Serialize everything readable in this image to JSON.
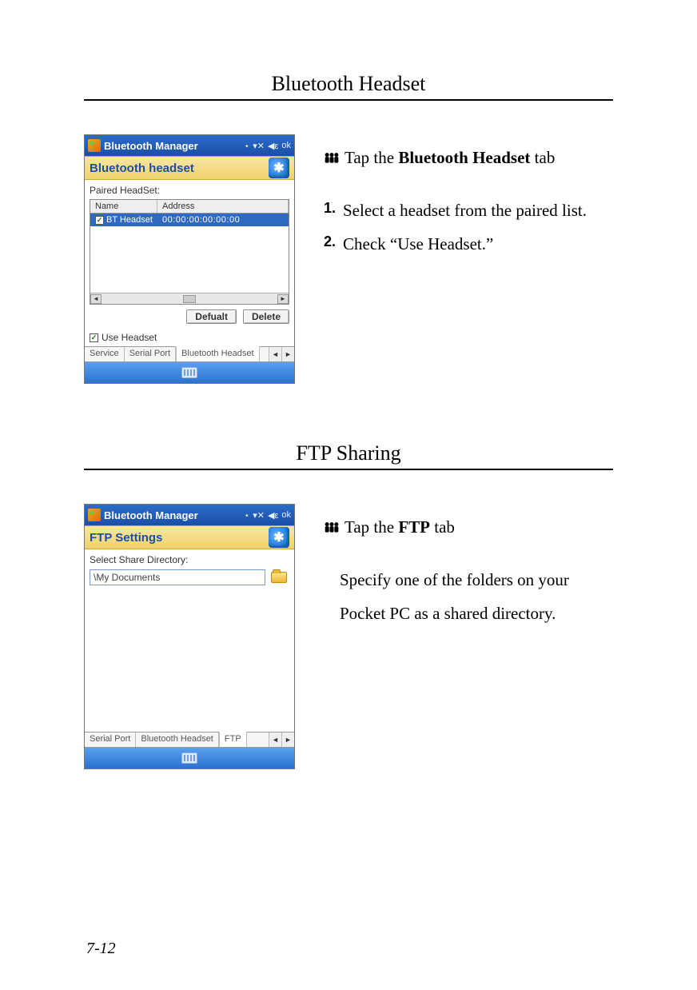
{
  "section1": {
    "title": "Bluetooth Headset"
  },
  "section2": {
    "title": "FTP Sharing"
  },
  "footer": "7-12",
  "right1": {
    "lead_prefix": "Tap the ",
    "lead_bold": "Bluetooth Headset",
    "lead_suffix": " tab",
    "steps": [
      "Select a headset from the paired list.",
      "Check “Use Headset.”"
    ]
  },
  "right2": {
    "lead_prefix": "Tap the ",
    "lead_bold": "FTP",
    "lead_suffix": " tab",
    "body": "Specify one of the folders on your Pocket PC as a shared directory."
  },
  "device1": {
    "titlebar": "Bluetooth Manager",
    "ok": "ok",
    "subtitle": "Bluetooth headset",
    "paired_label": "Paired HeadSet:",
    "col_name": "Name",
    "col_addr": "Address",
    "row_name": "BT Headset",
    "row_addr": "00:00:00:00:00:00",
    "btn_default": "Defualt",
    "btn_delete": "Delete",
    "use_headset": "Use Headset",
    "tabs": {
      "service": "Service",
      "serial": "Serial Port",
      "bt": "Bluetooth Headset"
    }
  },
  "device2": {
    "titlebar": "Bluetooth Manager",
    "ok": "ok",
    "subtitle": "FTP Settings",
    "select_label": "Select Share Directory:",
    "dir_value": "\\My Documents",
    "tabs": {
      "serial": "Serial Port",
      "bt": "Bluetooth Headset",
      "ftp": "FTP"
    }
  }
}
